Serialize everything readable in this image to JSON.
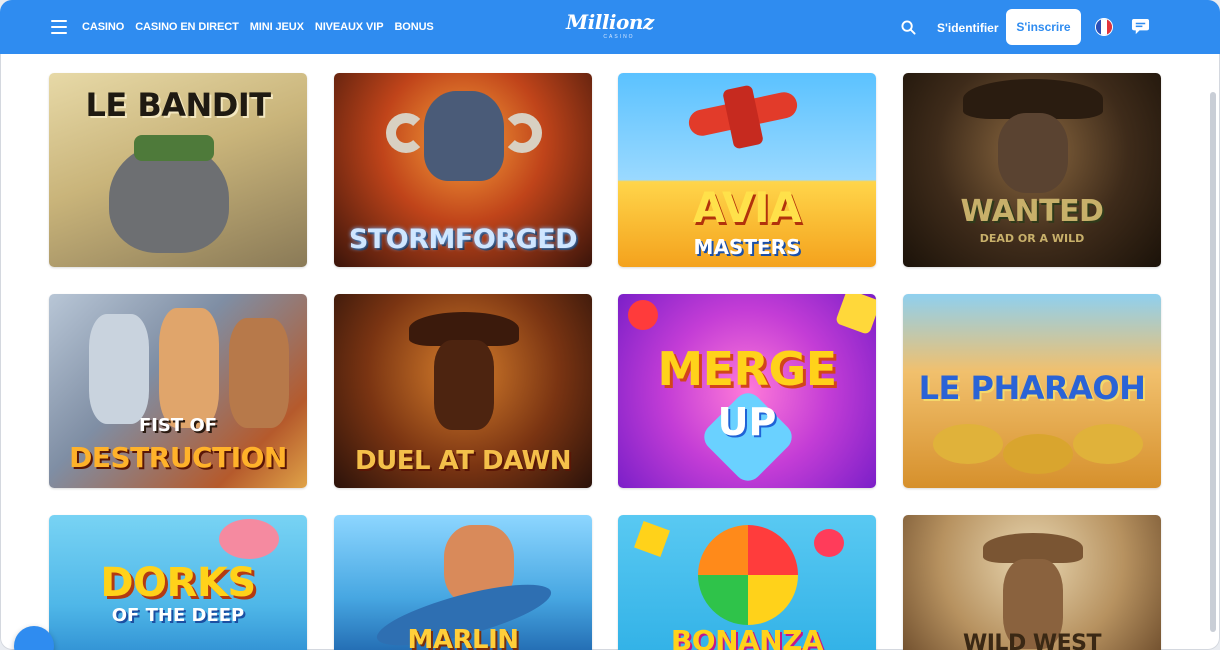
{
  "header": {
    "menu_icon": "hamburger-menu-icon",
    "nav": [
      "CASINO",
      "CASINO EN DIRECT",
      "MINI JEUX",
      "NIVEAUX VIP",
      "BONUS"
    ],
    "logo_text": "Millionz",
    "logo_sub": "CASINO",
    "search_icon": "search-icon",
    "login_label": "S'identifier",
    "signup_label": "S'inscrire",
    "language_icon": "french-flag-icon",
    "chat_icon": "chat-icon"
  },
  "colors": {
    "brand": "#2f8cf0",
    "page_bg": "#ffffff"
  },
  "games": [
    {
      "title": "LE BANDIT",
      "sub": ""
    },
    {
      "title": "STORMFORGED",
      "sub": ""
    },
    {
      "title": "AVIA",
      "sub": "MASTERS"
    },
    {
      "title": "WANTED",
      "sub": "DEAD OR A WILD"
    },
    {
      "title": "FIST OF",
      "sub": "DESTRUCTION"
    },
    {
      "title": "DUEL AT DAWN",
      "sub": ""
    },
    {
      "title": "MERGE",
      "sub": "UP"
    },
    {
      "title": "LE PHARAOH",
      "sub": ""
    },
    {
      "title": "DORKS",
      "sub": "OF THE DEEP"
    },
    {
      "title": "MARLIN",
      "sub": ""
    },
    {
      "title": "BONANZA",
      "sub": ""
    },
    {
      "title": "WILD WEST",
      "sub": ""
    }
  ]
}
